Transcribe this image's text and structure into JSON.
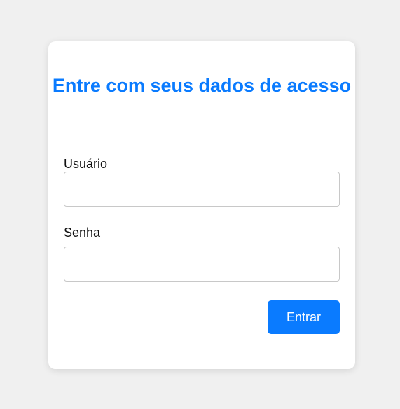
{
  "login": {
    "title": "Entre com seus dados de acesso",
    "username_label": "Usuário",
    "username_value": "",
    "password_label": "Senha",
    "password_value": "",
    "submit_label": "Entrar"
  },
  "colors": {
    "page_background": "#f0f0f0",
    "card_background": "#ffffff",
    "accent": "#0a7bff",
    "input_border": "#c8c8c8",
    "text": "#111111"
  }
}
